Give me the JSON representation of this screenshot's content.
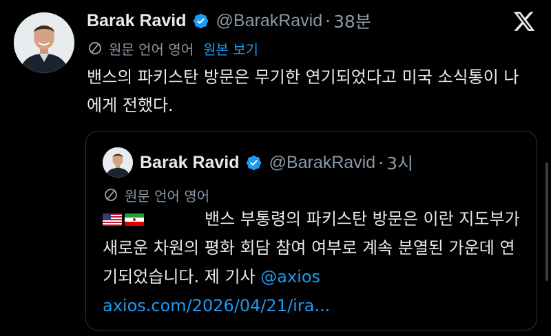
{
  "tweet": {
    "author_name": "Barak Ravid",
    "handle": "@BarakRavid",
    "separator": "·",
    "time": "38분",
    "translation_label": "원문 언어 영어",
    "show_original": "원본 보기",
    "body": "밴스의 파키스탄 방문은 무기한 연기되었다고 미국 소식통이 나에게 전했다."
  },
  "quoted": {
    "author_name": "Barak Ravid",
    "handle": "@BarakRavid",
    "separator": "·",
    "time": "3시",
    "translation_label": "원문 언어 영어",
    "flags": [
      "us-flag",
      "iran-flag"
    ],
    "body": "밴스 부통령의 파키스탄 방문은 이란 지도부가 새로운 차원의 평화 회담 참여 여부로 계속 분열된 가운데 연기되었습니다. 제 기사 ",
    "mention": "@axios",
    "link": "axios.com/2026/04/21/ira..."
  },
  "colors": {
    "background": "#000000",
    "text": "#e7e9ea",
    "secondary": "#8b98a5",
    "accent": "#1d9bf0"
  }
}
